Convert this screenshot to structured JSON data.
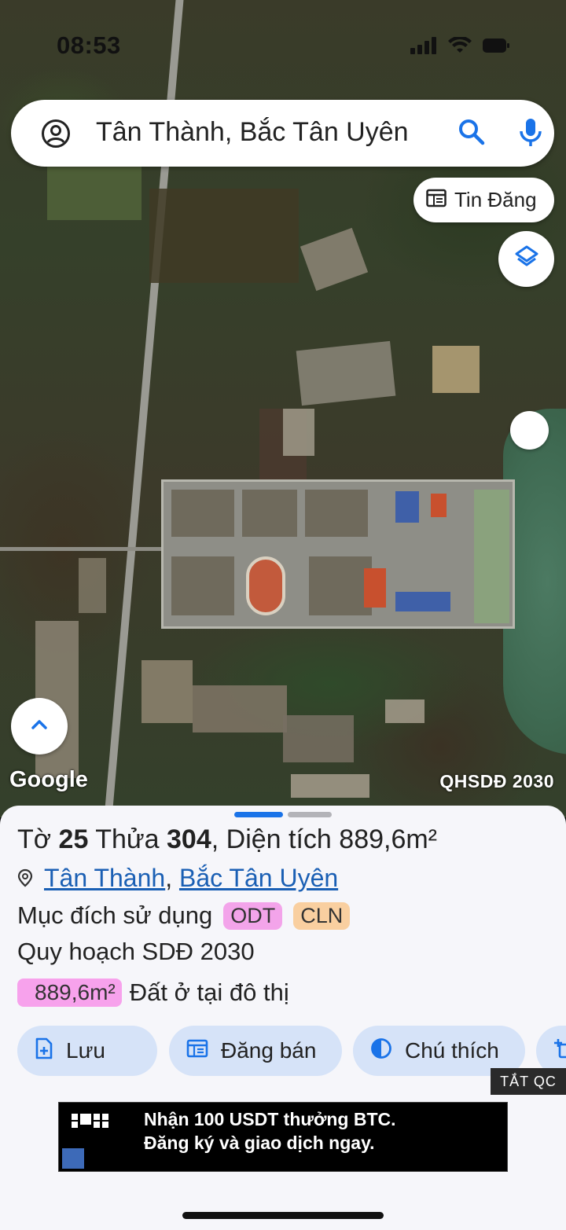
{
  "status_bar": {
    "time": "08:53",
    "icons": [
      "location-arrow-icon",
      "signal-icon",
      "wifi-icon",
      "battery-icon"
    ]
  },
  "search": {
    "query": "Tân Thành, Bắc Tân Uyên",
    "icons": [
      "account-icon",
      "search-icon",
      "mic-icon"
    ]
  },
  "map": {
    "buttons": {
      "listings_label": "Tin Đăng"
    },
    "google_logo": "Google",
    "layer_label": "QHSDĐ 2030"
  },
  "parcel": {
    "to_label": "Tờ",
    "to_number": "25",
    "thua_label": "Thửa",
    "thua_number": "304",
    "area_label": ", Diện tích",
    "area_value": "889,6m²",
    "ward": "Tân Thành",
    "district": "Bắc Tân Uyên",
    "separator": ",",
    "usage_label": "Mục đích sử dụng",
    "usage_tags": [
      "ODT",
      "CLN"
    ],
    "plan_label": "Quy hoạch SDĐ 2030",
    "plan_area": "889,6m²",
    "plan_type": "Đất ở tại đô thị"
  },
  "actions": [
    {
      "label": "Lưu",
      "icon": "add-file-icon"
    },
    {
      "label": "Đăng bán",
      "icon": "listing-icon"
    },
    {
      "label": "Chú thích",
      "icon": "contrast-icon"
    }
  ],
  "ad": {
    "close_label": "TẮT QC",
    "line1": "Nhận 100 USDT thưởng BTC.",
    "line2": "Đăng ký và giao dịch ngay."
  },
  "colors": {
    "accent": "#1a73e8",
    "action_bg": "#d6e3f8",
    "odt": "#f3a4ea",
    "cln": "#f9cfa0"
  }
}
